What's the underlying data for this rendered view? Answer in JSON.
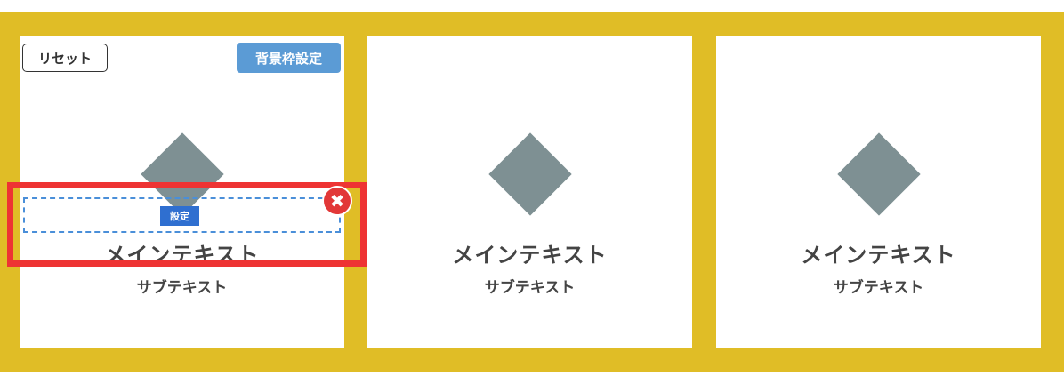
{
  "toolbar": {
    "reset_label": "リセット",
    "background_label": "背景枠設定"
  },
  "editor": {
    "setting_badge": "設定",
    "close_glyph": "✖"
  },
  "cards": [
    {
      "main_text": "メインテキスト",
      "sub_text": "サブテキスト"
    },
    {
      "main_text": "メインテキスト",
      "sub_text": "サブテキスト"
    },
    {
      "main_text": "メインテキスト",
      "sub_text": "サブテキスト"
    }
  ],
  "colors": {
    "background_band": "#E0BD26",
    "diamond": "#7E9093",
    "selection_frame": "#EE3333",
    "button_blue": "#5B9BD5",
    "badge_blue": "#2F6FD0"
  }
}
